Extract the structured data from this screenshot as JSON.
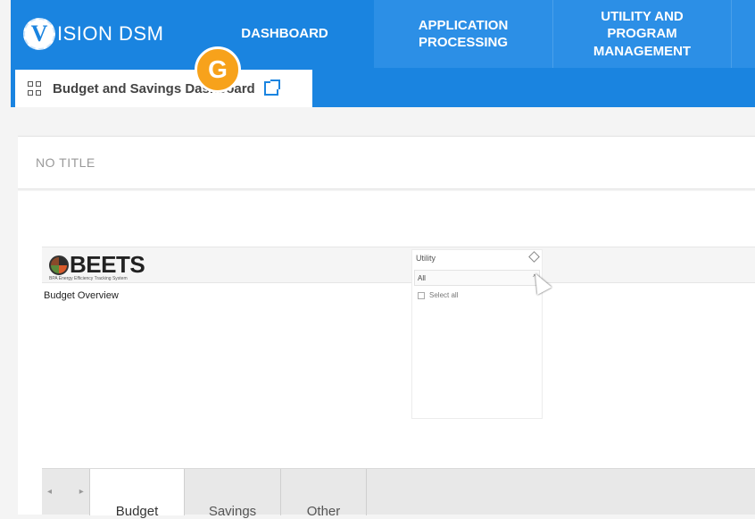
{
  "header": {
    "logo_text_prefix": "ISION",
    "logo_text_suffix": "DSM",
    "logo_letter": "V",
    "nav": [
      {
        "label": "DASHBOARD"
      },
      {
        "label": "APPLICATION PROCESSING"
      },
      {
        "label": "UTILITY AND PROGRAM MANAGEMENT"
      }
    ],
    "colors": {
      "primary": "#1a84e0",
      "accent": "#f7a21b"
    }
  },
  "tab": {
    "label": "Budget and Savings Dashboard",
    "badge": "G"
  },
  "panel": {
    "title": "NO TITLE"
  },
  "report": {
    "brand": "BEETS",
    "brand_sub": "BPA Energy Efficiency Tracking System",
    "section_title": "Budget Overview",
    "slicer": {
      "title": "Utility",
      "selected": "All",
      "options": [
        "Select all"
      ]
    },
    "page_tabs": [
      "Budget",
      "Savings",
      "Other"
    ]
  }
}
